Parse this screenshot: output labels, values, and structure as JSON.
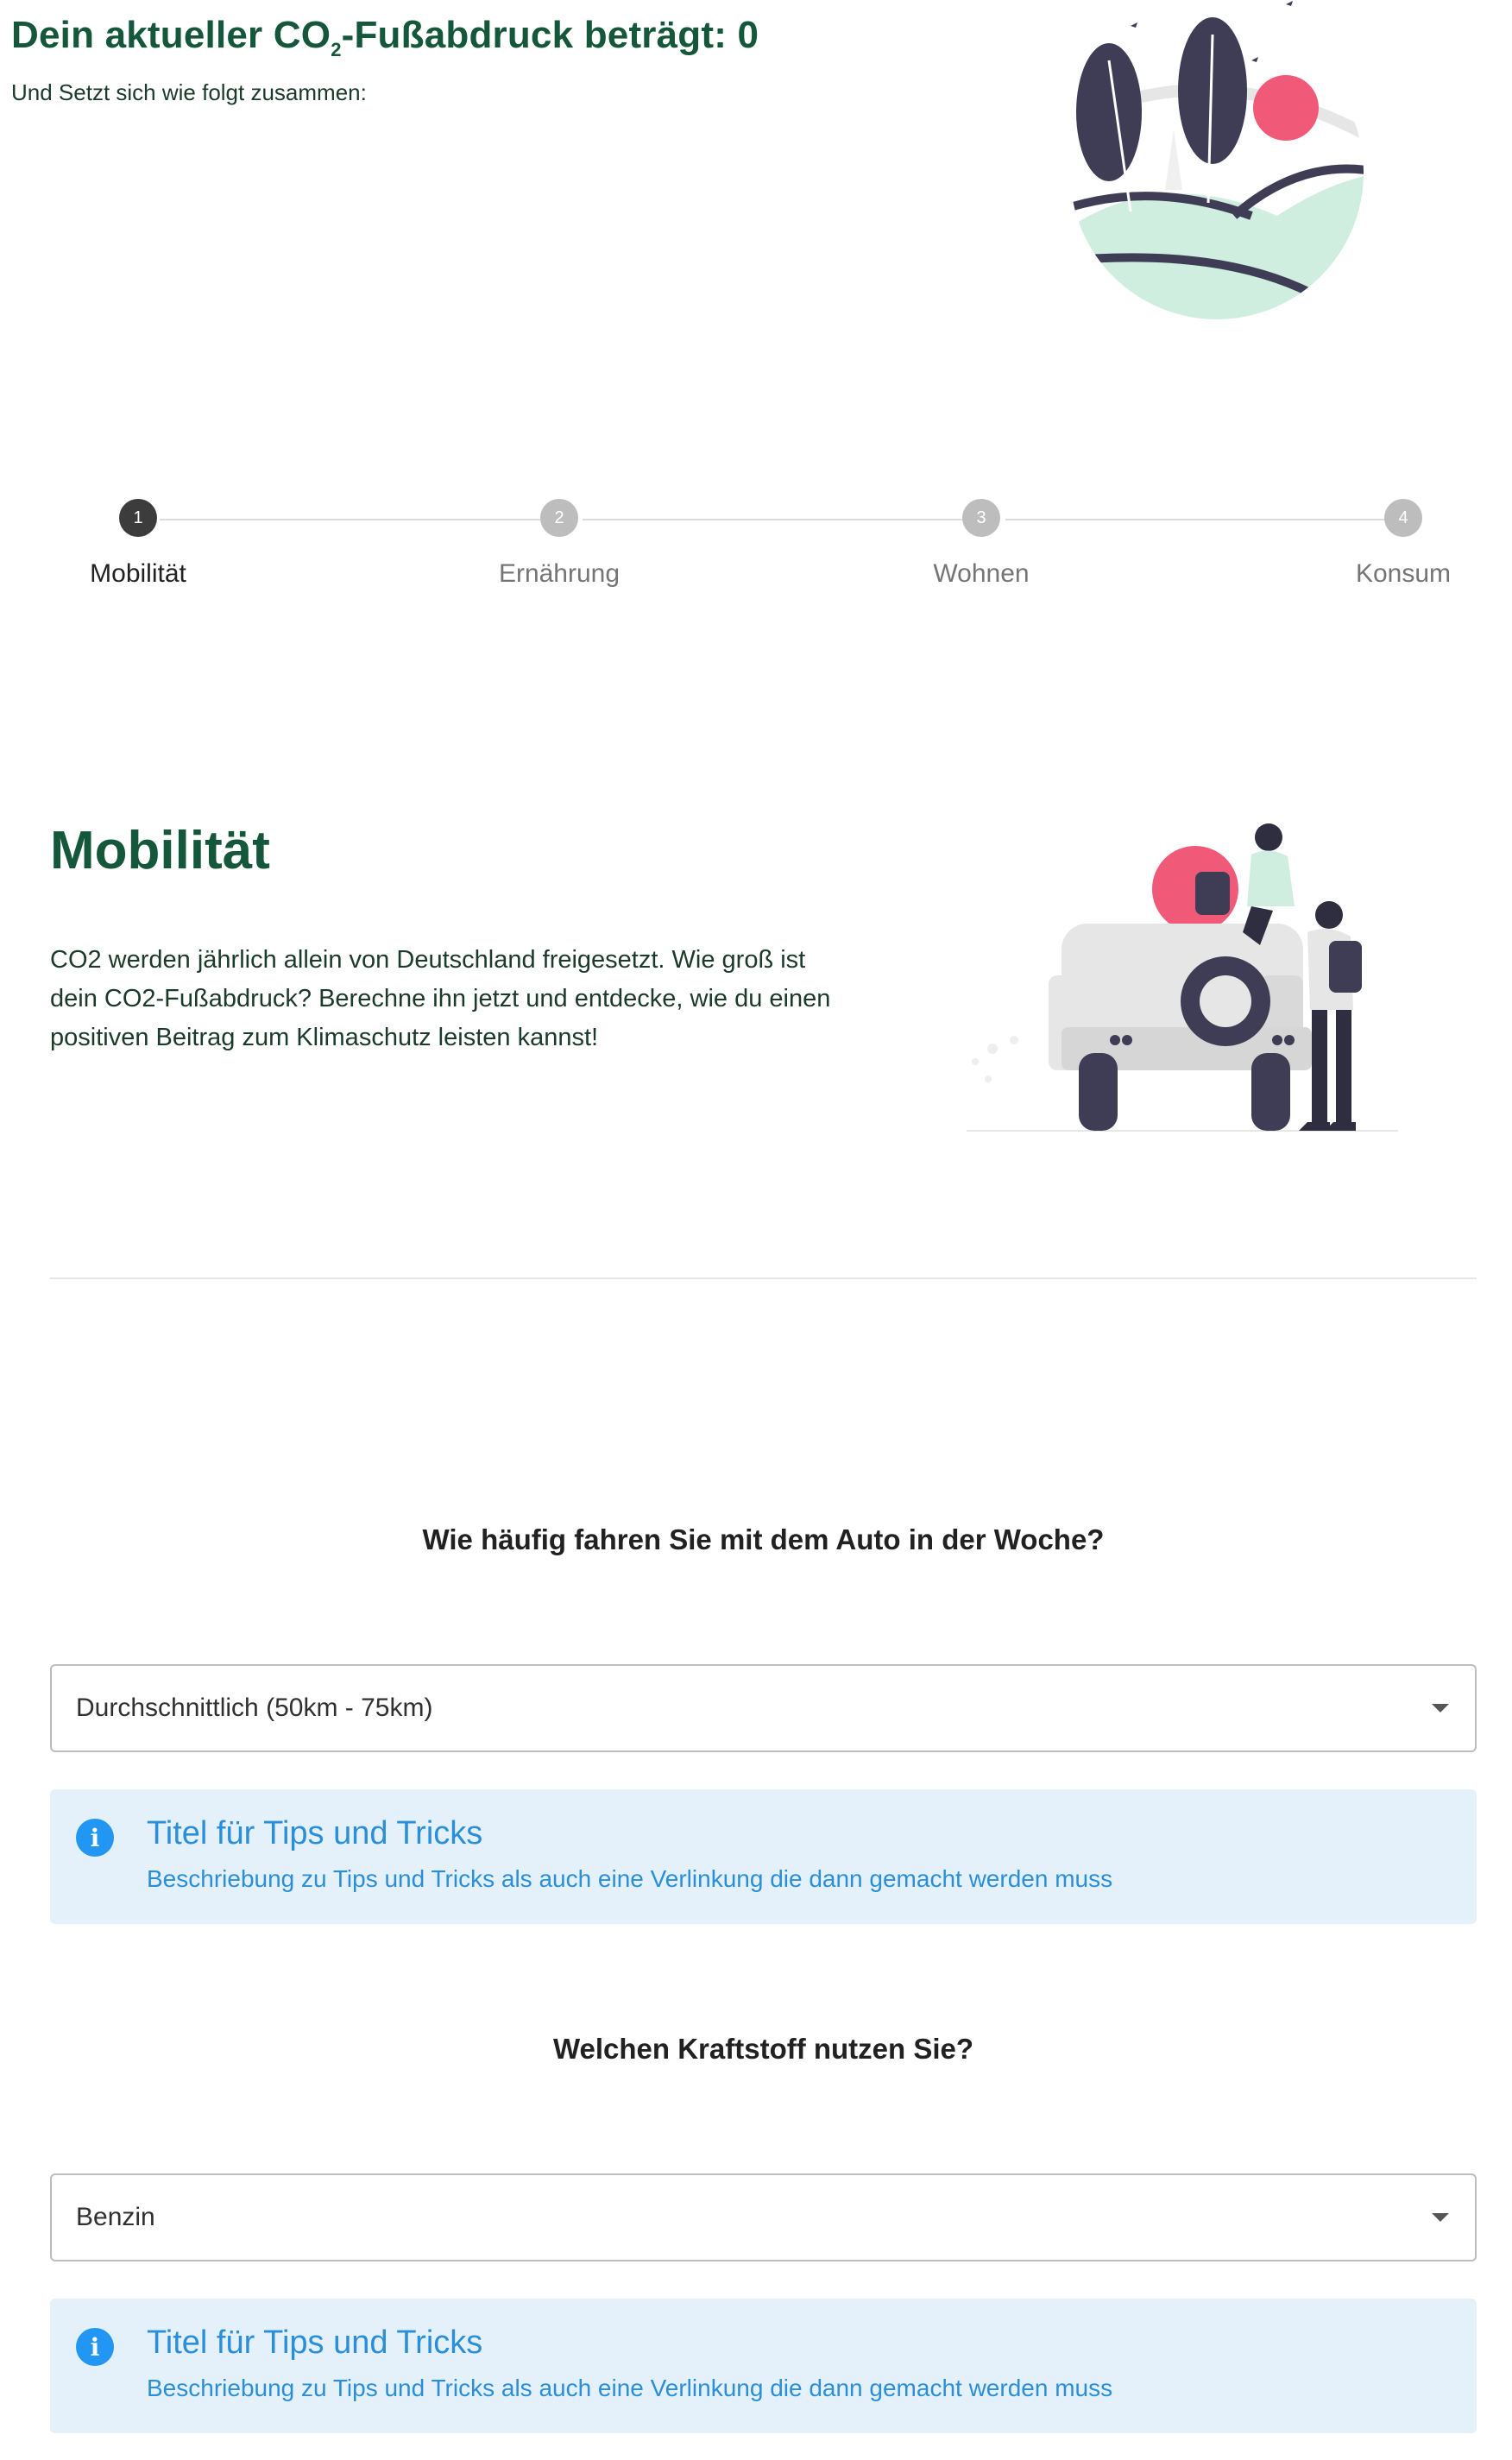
{
  "header": {
    "title_prefix": "Dein aktueller CO",
    "title_sub": "2",
    "title_suffix": "-Fußabdruck beträgt: 0",
    "subtitle": "Und Setzt sich wie folgt zusammen:"
  },
  "stepper": {
    "active_index": 0,
    "steps": [
      {
        "number": "1",
        "label": "Mobilität"
      },
      {
        "number": "2",
        "label": "Ernährung"
      },
      {
        "number": "3",
        "label": "Wohnen"
      },
      {
        "number": "4",
        "label": "Konsum"
      }
    ]
  },
  "intro": {
    "title": "Mobilität",
    "text": "CO2 werden jährlich allein von Deutschland freigesetzt. Wie groß ist dein CO2-Fußabdruck? Berechne ihn jetzt und entdecke, wie du einen positiven Beitrag zum Klimaschutz leisten kannst!"
  },
  "questions": [
    {
      "question": "Wie häufig fahren Sie mit dem Auto in der Woche?",
      "selected": "Durchschnittlich (50km - 75km)",
      "tip_title": "Titel für Tips und Tricks",
      "tip_text": "Beschriebung zu Tips und Tricks als auch eine Verlinkung die dann gemacht werden muss"
    },
    {
      "question": "Welchen Kraftstoff nutzen Sie?",
      "selected": "Benzin",
      "tip_title": "Titel für Tips und Tricks",
      "tip_text": "Beschriebung zu Tips und Tricks als auch eine Verlinkung die dann gemacht werden muss"
    }
  ],
  "icons": {
    "info": "info-icon",
    "dropdown": "chevron-down-icon"
  },
  "colors": {
    "brand_green": "#14573a",
    "info_blue": "#2a8fd8",
    "info_bg": "#e4f1fb",
    "accent_pink": "#f05a78",
    "mint": "#cfeee0",
    "dark_purple": "#3f3d56"
  }
}
